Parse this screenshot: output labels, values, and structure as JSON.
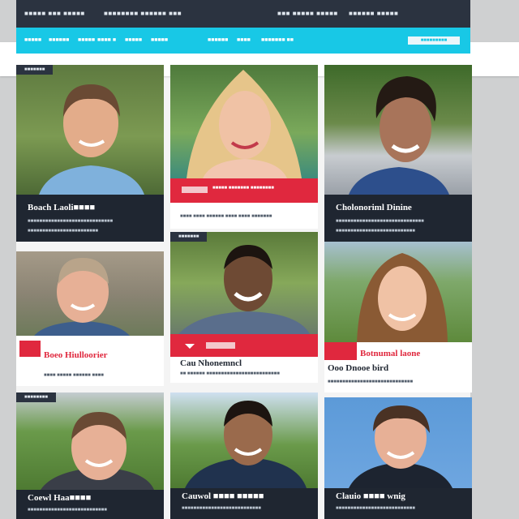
{
  "topbar": {
    "left_1": "■■■■■ ■■■ ■■■■■",
    "left_2": "■■■■■■■■ ■■■■■■ ■■■",
    "right_1": "■■■ ■■■■■ ■■■■■",
    "right_2": "■■■■■■ ■■■■■"
  },
  "nav": {
    "items": [
      "■■■■■",
      "■■■■■■",
      "■■■■■",
      "■■■■ ■",
      "■■■■■",
      "■■■■■",
      "■■■■■■",
      "■■■■",
      "■■■■■■■ ■■"
    ],
    "button_label": "■■■■■■■■■"
  },
  "cards": {
    "c1": {
      "tag": "■■■■■■■",
      "name": "Boach Laoli■■■■",
      "line1": "■■■■■■■■■■■■■■■■■■■■■■■■■■■■■",
      "line2": "■■■■■■■■■■■■■■■■■■■■■■■■"
    },
    "c2": {
      "red_text": "■■■■■ ■■■■■■■ ■■■■■■■■",
      "sub": "■■■■ ■■■■ ■■■■■■ ■■■■ ■■■■ ■■■■■■■"
    },
    "c3": {
      "name": "Cholonoriml Dinine",
      "line1": "■■■■■■■■■■■■■■■■■■■■■■■■■■■■■■",
      "line2": "■■■■■■■■■■■■■■■■■■■■■■■■■■■"
    },
    "c4": {
      "red_name": "Boeo Hiulloorier",
      "sub": "■■■■ ■■■■■ ■■■■■■ ■■■■"
    },
    "c5": {
      "tag": "■■■■■■■",
      "name": "Cau Nhonemncl",
      "sub": "■■ ■■■■■■ ■■■■■■■■■■■■■■■■■■■■■■■■■"
    },
    "c6": {
      "red_name": "Botnumal laone",
      "name": "Ooo Dnooe bird",
      "sub": "■■■■■■■■■■■■■■■■■■■■■■■■■■■■■"
    },
    "c7": {
      "tag": "■■■■■■■■",
      "name": "Coewl Haa■■■■",
      "line1": "■■■■■■■■■■■■■■■■■■■■■■■■■■■"
    },
    "c8": {
      "name": "Cauwol ■■■■ ■■■■■",
      "line1": "■■■■■■■■■■■■■■■■■■■■■■■■■■■"
    },
    "c9": {
      "name": "Clauio ■■■■ wnig",
      "line1": "■■■■■■■■■■■■■■■■■■■■■■■■■■■"
    }
  },
  "colors": {
    "nav_accent": "#18c8e6",
    "topbar": "#2b3340",
    "card_red": "#e0283e",
    "caption_dark": "#1f2631"
  }
}
